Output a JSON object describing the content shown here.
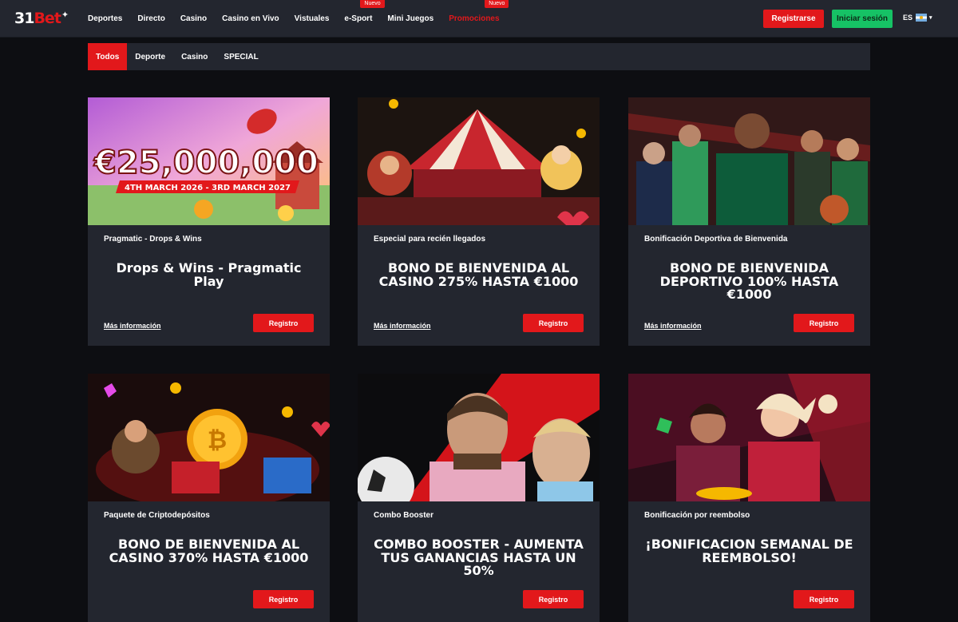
{
  "header": {
    "logo": {
      "num": "31",
      "bet": "Bet",
      "star": "✦"
    },
    "nav": [
      {
        "label": "Deportes"
      },
      {
        "label": "Directo"
      },
      {
        "label": "Casino"
      },
      {
        "label": "Casino en Vivo"
      },
      {
        "label": "Vistuales"
      },
      {
        "label": "e-Sport",
        "badge": "Nuevo"
      },
      {
        "label": "Mini Juegos"
      },
      {
        "label": "Promociones",
        "badge": "Nuevo"
      }
    ],
    "register_label": "Registrarse",
    "login_label": "Iniciar sesión",
    "language": "ES",
    "caret": "▾"
  },
  "tabs": [
    {
      "label": "Todos",
      "active": true
    },
    {
      "label": "Deporte"
    },
    {
      "label": "Casino"
    },
    {
      "label": "SPECIAL"
    }
  ],
  "colors": {
    "accent": "#e2181b",
    "login": "#16c265",
    "card_bg": "#23262f",
    "page_bg": "#0d0e12"
  },
  "cards": [
    {
      "image_text": "€25,000,000",
      "image_ribbon": "4TH MARCH 2026 - 3RD MARCH 2027",
      "category": "Pragmatic - Drops & Wins",
      "title": "Drops & Wins - Pragmatic Play",
      "more": "Más información",
      "button": "Registro"
    },
    {
      "category": "Especial para recién llegados",
      "title": "BONO DE BIENVENIDA AL CASINO 275% HASTA €1000",
      "more": "Más información",
      "button": "Registro"
    },
    {
      "category": "Bonificación Deportiva de Bienvenida",
      "title": "BONO DE BIENVENIDA DEPORTIVO 100% HASTA €1000",
      "more": "Más información",
      "button": "Registro"
    },
    {
      "category": "Paquete de Criptodepósitos",
      "title": "BONO DE BIENVENIDA AL CASINO 370% HASTA €1000",
      "button": "Registro"
    },
    {
      "category": "Combo Booster",
      "title": "COMBO BOOSTER - AUMENTA TUS GANANCIAS HASTA UN 50%",
      "button": "Registro"
    },
    {
      "category": "Bonificación por reembolso",
      "title": "¡BONIFICACION SEMANAL DE REEMBOLSO!",
      "button": "Registro"
    }
  ]
}
